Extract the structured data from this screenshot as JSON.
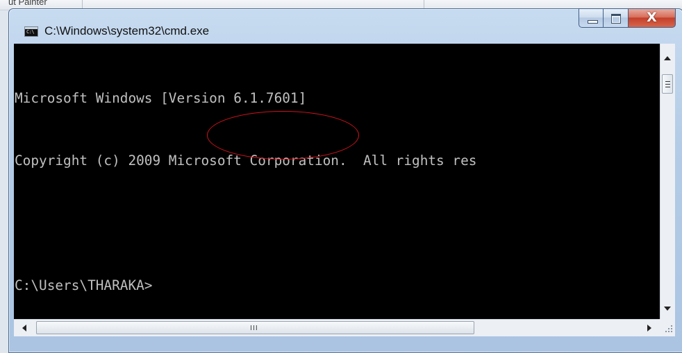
{
  "background_app": {
    "partial_text": "ut Painter"
  },
  "window": {
    "title": "C:\\Windows\\system32\\cmd.exe",
    "icon_text": "C:\\",
    "buttons": {
      "minimize_icon": "minimize-icon",
      "maximize_icon": "maximize-icon",
      "close_glyph": "X"
    }
  },
  "console": {
    "lines": [
      "Microsoft Windows [Version 6.1.7601]",
      "Copyright (c) 2009 Microsoft Corporation.  All rights res",
      "",
      "C:\\Users\\THARAKA>"
    ],
    "text_color": "#c0c0c0",
    "background": "#000000",
    "annotation_color": "#d0121a"
  },
  "scrollbars": {
    "horizontal_grip": "III"
  }
}
